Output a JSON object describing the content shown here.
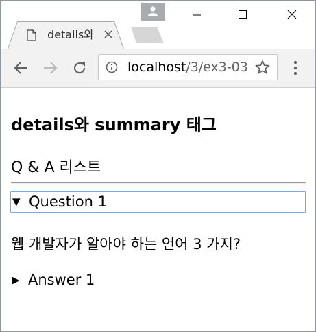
{
  "browser": {
    "tab_title": "details와",
    "url_host": "localhost",
    "url_path": "/3/ex3-03"
  },
  "page": {
    "heading": "details와 summary 태그",
    "subtitle": "Q & A 리스트",
    "details": [
      {
        "summary": "Question 1",
        "open": true,
        "body": "웹 개발자가 알아야 하는 언어 3 가지?"
      },
      {
        "summary": "Answer 1",
        "open": false
      }
    ]
  },
  "icons": {
    "tab": "page-icon",
    "close": "close-icon",
    "back": "back-arrow-icon",
    "forward": "forward-arrow-icon",
    "reload": "reload-icon",
    "info": "info-icon",
    "star": "star-icon",
    "menu": "kebab-menu-icon"
  }
}
